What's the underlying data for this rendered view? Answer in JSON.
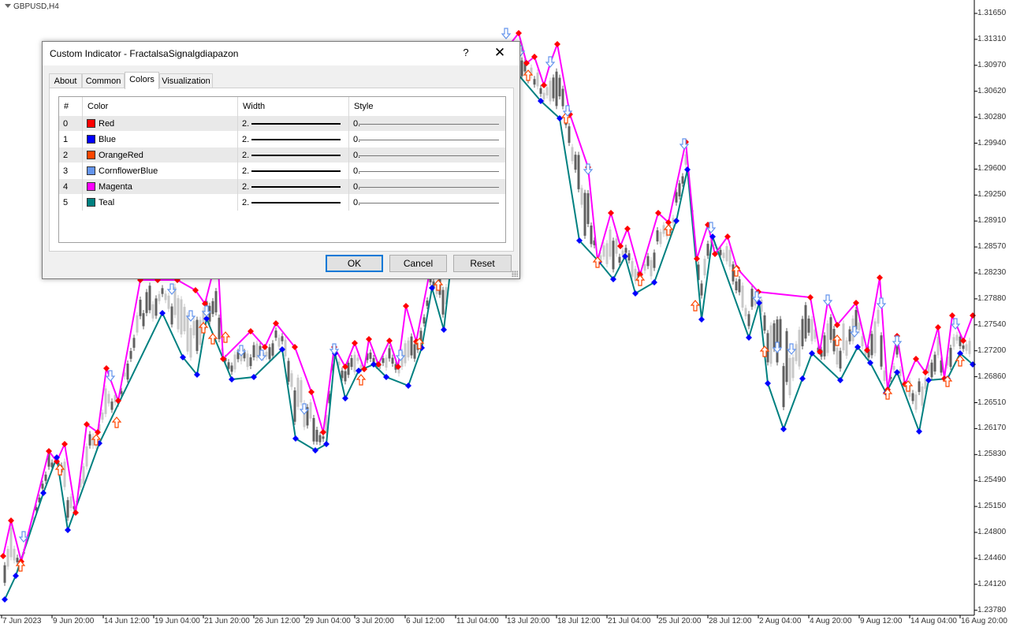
{
  "chart": {
    "title": "GBPUSD,H4",
    "price_labels": [
      "1.31650",
      "1.31310",
      "1.30970",
      "1.30620",
      "1.30280",
      "1.29940",
      "1.29600",
      "1.29250",
      "1.28910",
      "1.28570",
      "1.28230",
      "1.27880",
      "1.27540",
      "1.27200",
      "1.26860",
      "1.26510",
      "1.26170",
      "1.25830",
      "1.25490",
      "1.25150",
      "1.24800",
      "1.24460",
      "1.24120",
      "1.23780"
    ],
    "time_labels": [
      "7 Jun 2023",
      "9 Jun 20:00",
      "14 Jun 12:00",
      "19 Jun 04:00",
      "21 Jun 20:00",
      "26 Jun 12:00",
      "29 Jun 04:00",
      "3 Jul 20:00",
      "6 Jul 12:00",
      "11 Jul 04:00",
      "13 Jul 20:00",
      "18 Jul 12:00",
      "21 Jul 04:00",
      "25 Jul 20:00",
      "28 Jul 12:00",
      "2 Aug 04:00",
      "4 Aug 20:00",
      "9 Aug 12:00",
      "14 Aug 04:00",
      "16 Aug 20:00"
    ],
    "colors": {
      "upper_line": "#FF00FF",
      "lower_line": "#008080",
      "upper_fractal": "#FF0000",
      "lower_fractal": "#0000FF",
      "up_arrow": "#FF4500",
      "down_arrow": "#6495ED",
      "candle_bull": "#C8C8C8",
      "candle_bear": "#606060"
    }
  },
  "dialog": {
    "title": "Custom Indicator - FractalsaSignalgdiapazon",
    "help_label": "?",
    "close_label": "✕",
    "tabs": [
      {
        "label": "About"
      },
      {
        "label": "Common"
      },
      {
        "label": "Colors"
      },
      {
        "label": "Visualization"
      }
    ],
    "active_tab": "Colors",
    "columns": [
      "#",
      "Color",
      "Width",
      "Style"
    ],
    "rows": [
      {
        "index": "0",
        "color_name": "Red",
        "color_hex": "#FF0000",
        "width": "2.",
        "style": "0."
      },
      {
        "index": "1",
        "color_name": "Blue",
        "color_hex": "#0000FF",
        "width": "2.",
        "style": "0."
      },
      {
        "index": "2",
        "color_name": "OrangeRed",
        "color_hex": "#FF4500",
        "width": "2.",
        "style": "0."
      },
      {
        "index": "3",
        "color_name": "CornflowerBlue",
        "color_hex": "#6495ED",
        "width": "2.",
        "style": "0."
      },
      {
        "index": "4",
        "color_name": "Magenta",
        "color_hex": "#FF00FF",
        "width": "2.",
        "style": "0."
      },
      {
        "index": "5",
        "color_name": "Teal",
        "color_hex": "#008080",
        "width": "2.",
        "style": "0."
      }
    ],
    "buttons": {
      "ok": "OK",
      "cancel": "Cancel",
      "reset": "Reset"
    }
  }
}
